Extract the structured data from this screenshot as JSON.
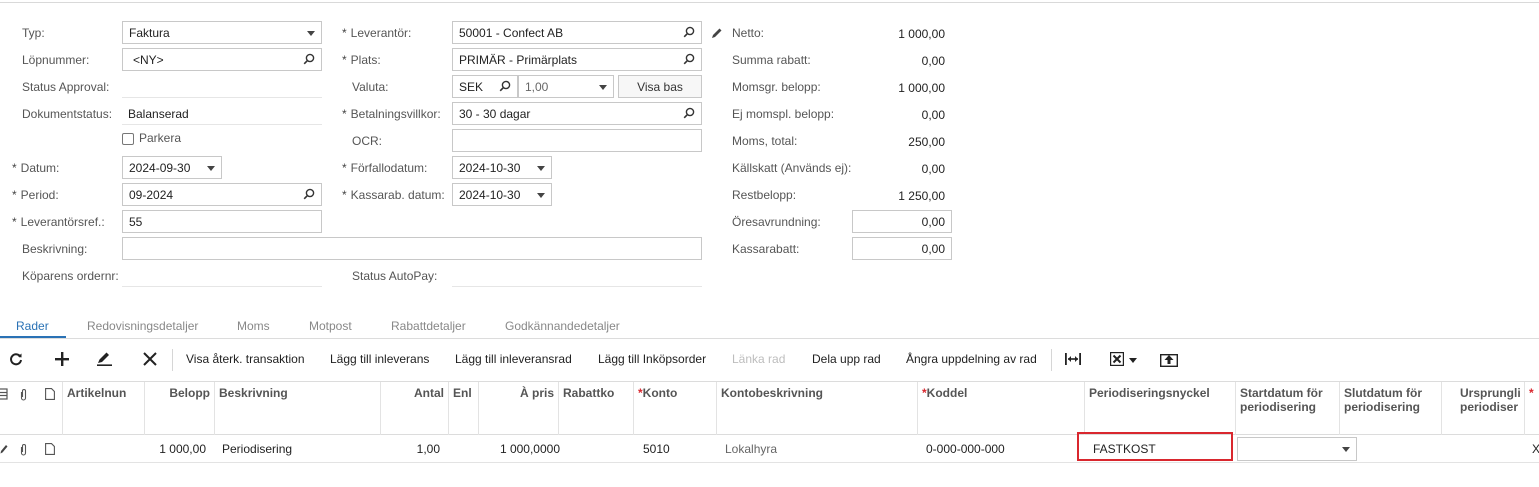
{
  "header": {
    "typ_label": "Typ:",
    "typ_value": "Faktura",
    "lopnummer_label": "Löpnummer:",
    "lopnummer_value": "<NY>",
    "status_approval_label": "Status Approval:",
    "dokumentstatus_label": "Dokumentstatus:",
    "dokumentstatus_value": "Balanserad",
    "parkera_label": "Parkera",
    "datum_label": "Datum:",
    "datum_value": "2024-09-30",
    "period_label": "Period:",
    "period_value": "09-2024",
    "leverantorsref_label": "Leverantörsref.:",
    "leverantorsref_value": "55",
    "beskrivning_label": "Beskrivning:",
    "beskrivning_value": "",
    "koparens_label": "Köparens ordernr:",
    "leverantor_label": "Leverantör:",
    "leverantor_value": "50001 - Confect AB",
    "plats_label": "Plats:",
    "plats_value": "PRIMÄR - Primärplats",
    "valuta_label": "Valuta:",
    "valuta_value": "SEK",
    "kurs_value": "1,00",
    "visa_bas_label": "Visa bas",
    "betalningsvillkor_label": "Betalningsvillkor:",
    "betalningsvillkor_value": "30 - 30 dagar",
    "ocr_label": "OCR:",
    "ocr_value": "",
    "forfallodatum_label": "Förfallodatum:",
    "forfallodatum_value": "2024-10-30",
    "kassarab_label": "Kassarab. datum:",
    "kassarab_value": "2024-10-30",
    "status_autopay_label": "Status AutoPay:",
    "required_mark": "*"
  },
  "totals": {
    "netto_label": "Netto:",
    "netto_value": "1 000,00",
    "summa_rabatt_label": "Summa rabatt:",
    "summa_rabatt_value": "0,00",
    "momsgr_label": "Momsgr. belopp:",
    "momsgr_value": "1 000,00",
    "ej_momspl_label": "Ej momspl. belopp:",
    "ej_momspl_value": "0,00",
    "moms_total_label": "Moms, total:",
    "moms_total_value": "250,00",
    "kallskatt_label": "Källskatt (Används ej):",
    "kallskatt_value": "0,00",
    "restbelopp_label": "Restbelopp:",
    "restbelopp_value": "1 250,00",
    "oresavrundning_label": "Öresavrundning:",
    "oresavrundning_value": "0,00",
    "kassarabatt_label": "Kassarabatt:",
    "kassarabatt_value": "0,00"
  },
  "tabs": [
    "Rader",
    "Redovisningsdetaljer",
    "Moms",
    "Motpost",
    "Rabattdetaljer",
    "Godkännandedetaljer"
  ],
  "toolbar": {
    "visa_aterk": "Visa återk. transaktion",
    "lagg_till_inleverans": "Lägg till inleverans",
    "lagg_till_inleveransrad": "Lägg till inleveransrad",
    "lagg_till_inkopsorder": "Lägg till Inköpsorder",
    "lanka_rad": "Länka rad",
    "dela_upp_rad": "Dela upp rad",
    "angra_uppdelning": "Ångra uppdelning av rad"
  },
  "grid": {
    "headers": {
      "artikelnr": "Artikelnun",
      "belopp": "Belopp",
      "beskrivning": "Beskrivning",
      "antal": "Antal",
      "enl": "Enl",
      "a_pris": "À pris",
      "rabattko": "Rabattko",
      "konto": "Konto",
      "kontobeskrivning": "Kontobeskrivning",
      "koddel": "Koddel",
      "periodiseringsnyckel": "Periodiseringsnyckel",
      "startdatum": "Startdatum för periodisering",
      "slutdatum": "Slutdatum för periodisering",
      "ursprungl": "Ursprungli periodiser"
    },
    "row": {
      "belopp": "1 000,00",
      "beskrivning": "Periodisering",
      "antal": "1,00",
      "a_pris": "1 000,0000",
      "konto": "5010",
      "kontobeskrivning": "Lokalhyra",
      "koddel": "0-000-000-000",
      "periodiseringsnyckel": "FASTKOST",
      "startdatum": "",
      "trailing": "X"
    }
  },
  "colors": {
    "accent": "#2a72b5",
    "highlight": "#d9272e"
  }
}
